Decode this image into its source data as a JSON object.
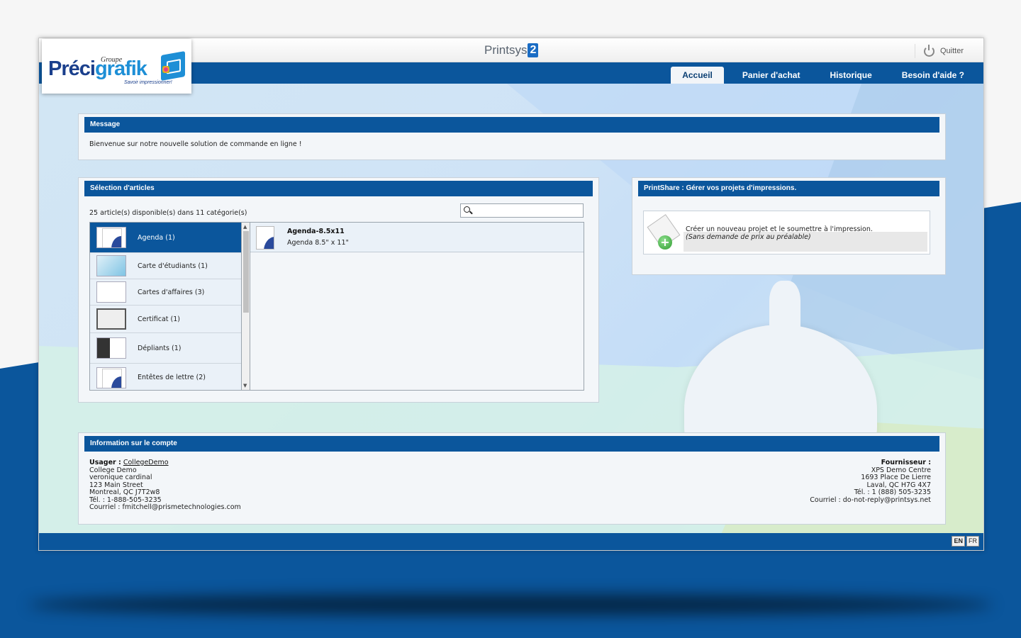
{
  "logo": {
    "groupe": "Groupe",
    "preci": "Préci",
    "grafik": "grafik",
    "tagline": "Savoir impressionner!"
  },
  "brand": {
    "text": "Printsys",
    "num": "2"
  },
  "header": {
    "quit_label": "Quitter"
  },
  "tabs": [
    {
      "label": "Accueil",
      "active": true
    },
    {
      "label": "Panier d'achat",
      "active": false
    },
    {
      "label": "Historique",
      "active": false
    },
    {
      "label": "Besoin d'aide ?",
      "active": false
    }
  ],
  "message": {
    "title": "Message",
    "text": "Bienvenue sur notre nouvelle solution de commande en ligne !"
  },
  "selection": {
    "title": "Sélection d'articles",
    "count": "25 article(s) disponible(s) dans 11 catégorie(s)",
    "search_placeholder": "",
    "categories": [
      {
        "label": "Agenda (1)",
        "icon": "page-thumb"
      },
      {
        "label": "Carte d'étudiants (1)",
        "icon": "card-thumb"
      },
      {
        "label": "Cartes d'affaires (3)",
        "icon": "business-card-thumb"
      },
      {
        "label": "Certificat (1)",
        "icon": "certificate-thumb"
      },
      {
        "label": "Dépliants (1)",
        "icon": "flyer-thumb"
      },
      {
        "label": "Entêtes de lettre (2)",
        "icon": "letterhead-thumb"
      }
    ],
    "items": [
      {
        "name": "Agenda-8.5x11",
        "desc": "Agenda 8.5\" x 11\""
      }
    ]
  },
  "printshare": {
    "title": "PrintShare : Gérer vos projets d'impressions.",
    "line1": "Créer un nouveau projet et le soumettre à l'impression.",
    "line2": "(Sans demande de prix au préalable)"
  },
  "account": {
    "title": "Information sur le compte",
    "user_label": "Usager :",
    "user_name": "CollegeDemo",
    "user_lines": [
      "College Demo",
      "veronique cardinal",
      "123 Main Street",
      "Montreal, QC J7T2w8",
      "Tél. : 1-888-505-3235",
      "Courriel : fmitchell@prismetechnologies.com"
    ],
    "supplier_label": "Fournisseur :",
    "supplier_lines": [
      "XPS Demo Centre",
      "1693 Place De Lierre",
      "Laval, QC H7G 4X7",
      "Tél. : 1 (888) 505-3235",
      "Courriel : do-not-reply@printsys.net"
    ]
  },
  "languages": [
    "EN",
    "FR"
  ],
  "colors": {
    "primary": "#0b569c",
    "panel_bg": "#f3f6f9"
  }
}
